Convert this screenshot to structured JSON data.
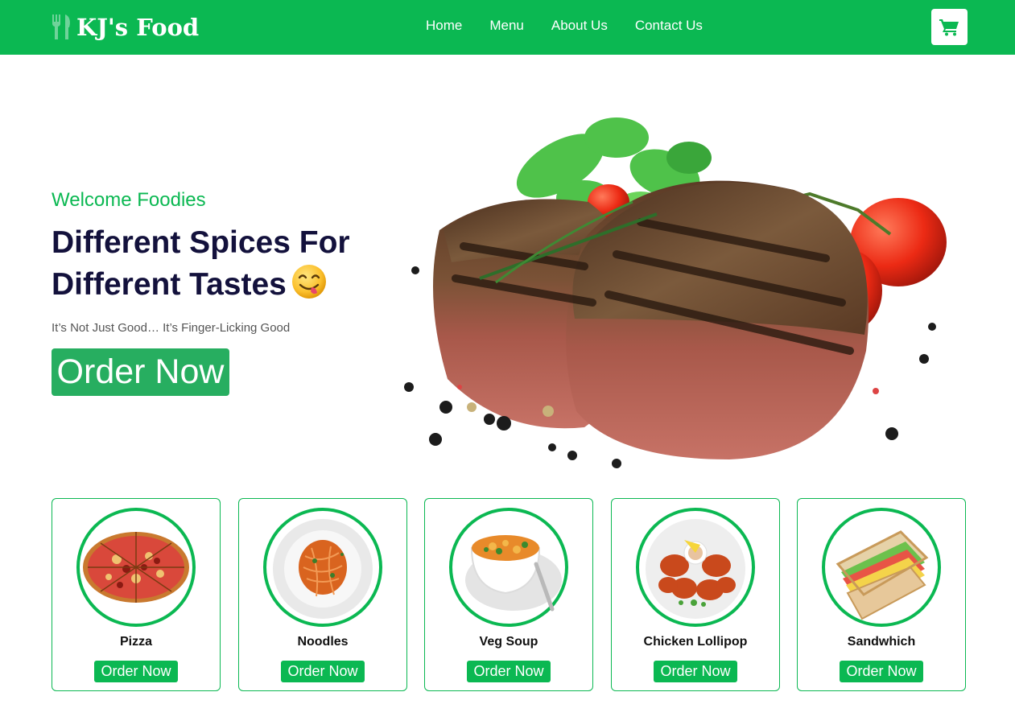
{
  "navbar": {
    "brand": "KJ's Food",
    "links": [
      "Home",
      "Menu",
      "About Us",
      "Contact Us"
    ],
    "cart_icon": "cart-icon",
    "color": "#0bb852"
  },
  "hero": {
    "subtitle": "Welcome Foodies",
    "title_line1": "Different Spices For",
    "title_line2": "Different Tastes",
    "title_emoji": "face-savoring-food-emoji",
    "tagline": "It’s Not Just Good… It’s Finger-Licking Good",
    "order_label": "Order Now",
    "image": "grilled-steak-photo"
  },
  "menu": {
    "items": [
      {
        "name": "Pizza",
        "order_label": "Order Now",
        "image": "pizza-photo"
      },
      {
        "name": "Noodles",
        "order_label": "Order Now",
        "image": "noodles-photo"
      },
      {
        "name": "Veg Soup",
        "order_label": "Order Now",
        "image": "veg-soup-photo"
      },
      {
        "name": "Chicken Lollipop",
        "order_label": "Order Now",
        "image": "chicken-lollipop-photo"
      },
      {
        "name": "Sandwhich",
        "order_label": "Order Now",
        "image": "sandwich-photo"
      }
    ]
  },
  "colors": {
    "accent": "#0bb852",
    "hero_button": "#27ae60",
    "title": "#13113c"
  }
}
